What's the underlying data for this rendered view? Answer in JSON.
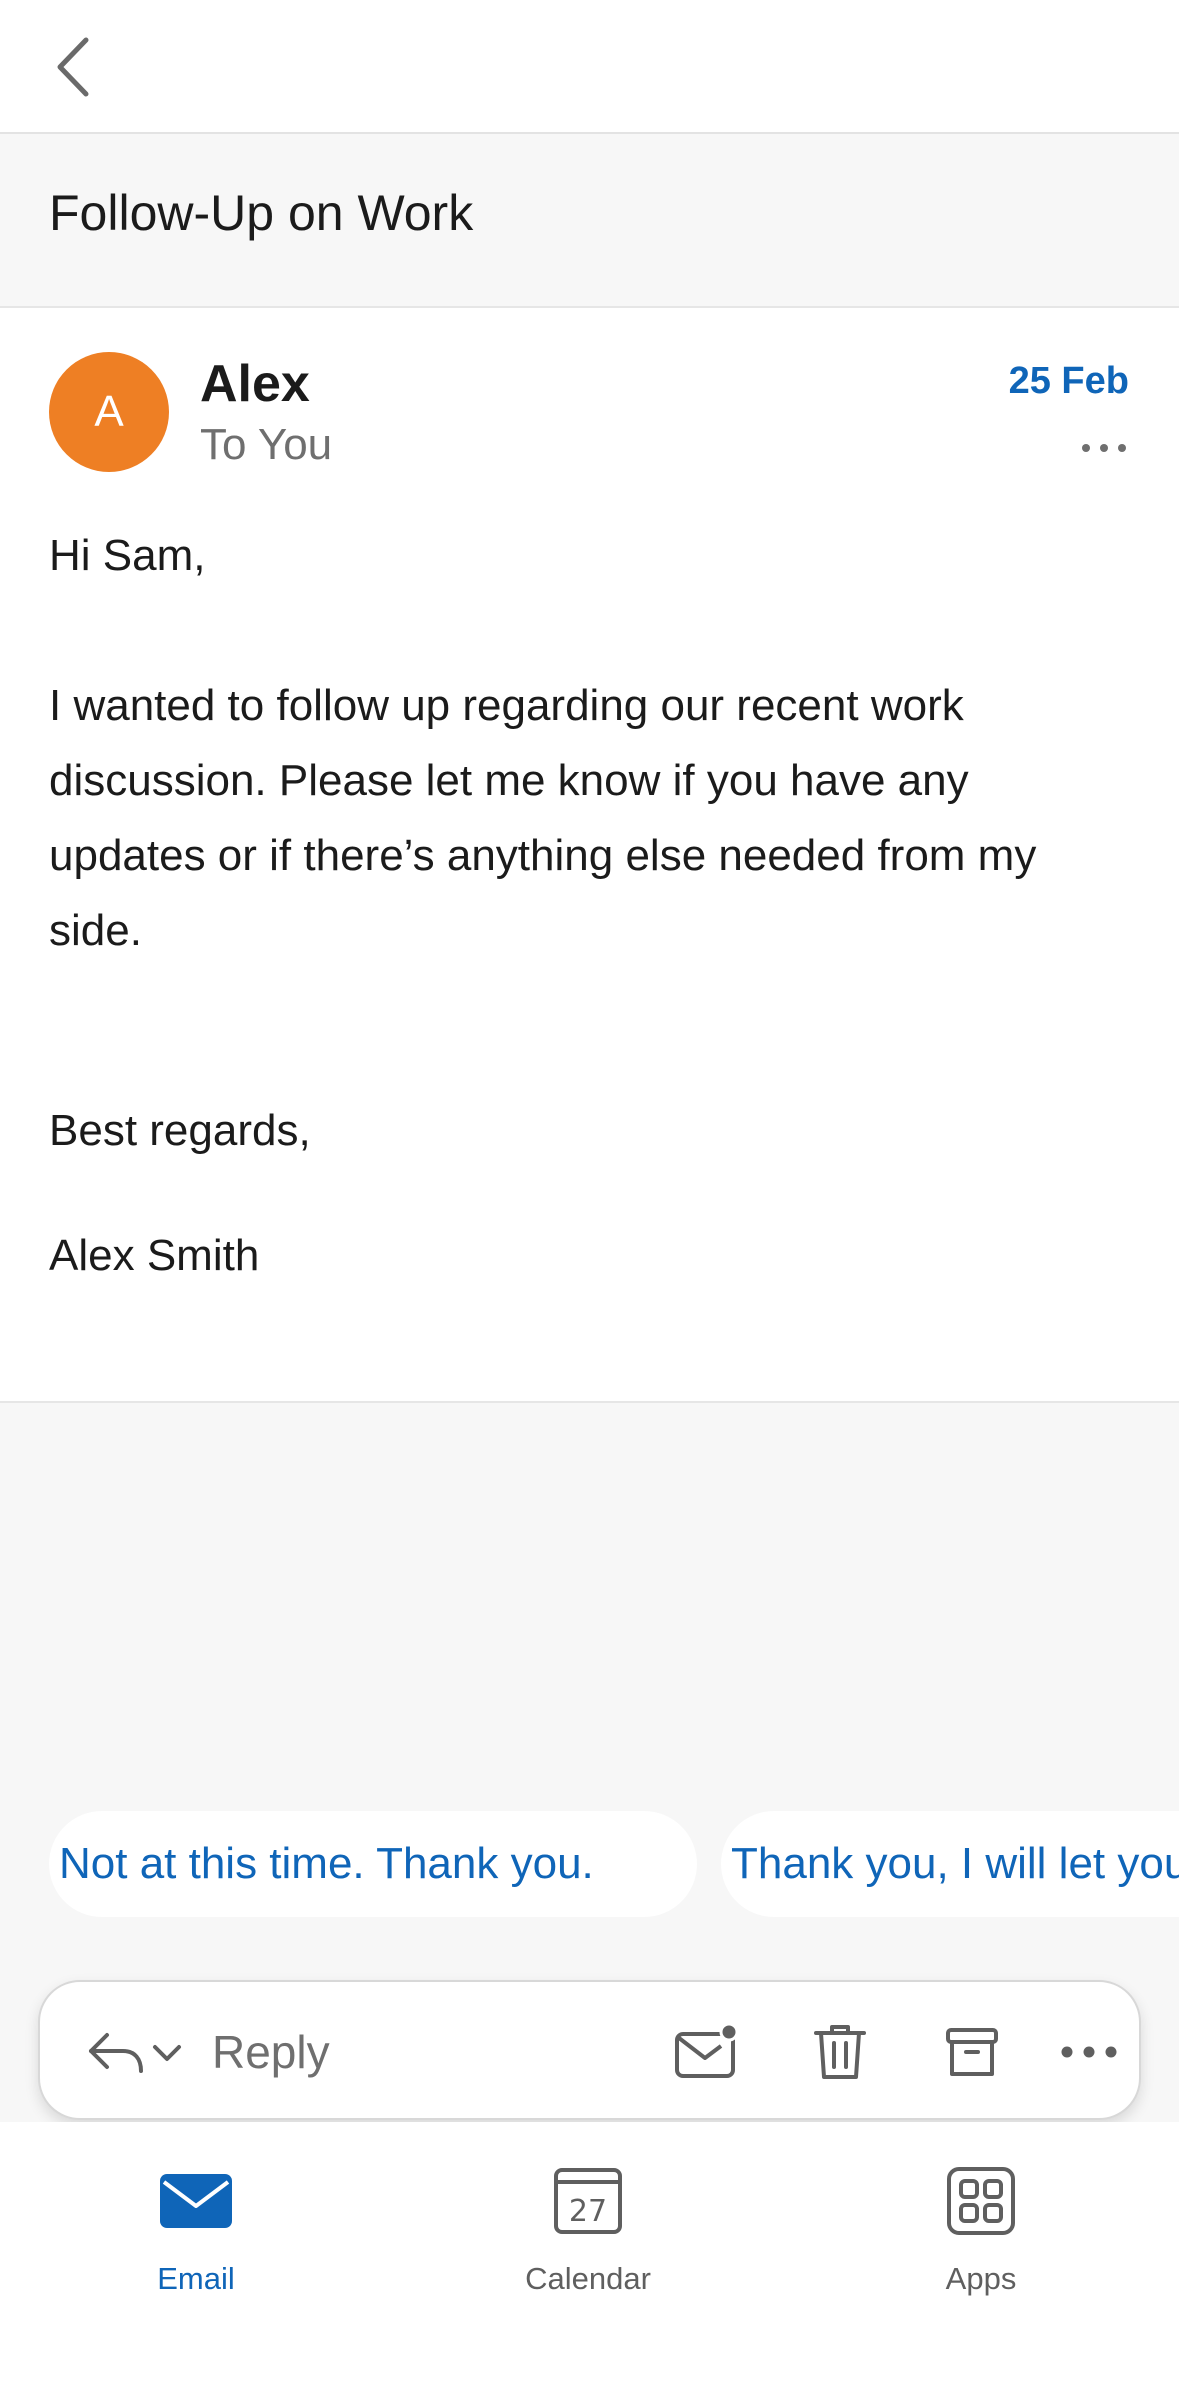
{
  "subject": "Follow-Up on Work",
  "message": {
    "avatar_initial": "A",
    "sender": "Alex",
    "recipient": "To You",
    "date": "25 Feb",
    "greeting": "Hi Sam,",
    "paragraph": "I wanted to follow up regarding our recent work discussion. Please let me know if you have any updates or if there’s anything else needed from my side.",
    "closing": "Best regards,",
    "signature": "Alex Smith"
  },
  "suggestions": [
    "Not at this time. Thank you.",
    "Thank you, I will let you know"
  ],
  "reply_bar": {
    "reply_label": "Reply"
  },
  "tabs": [
    {
      "label": "Email",
      "active": true
    },
    {
      "label": "Calendar",
      "calendar_day": "27"
    },
    {
      "label": "Apps"
    }
  ],
  "colors": {
    "accent": "#0f65b8",
    "avatar": "#ee7f24"
  },
  "icons": [
    "back-chevron-icon",
    "more-horizontal-icon",
    "reply-arrow-icon",
    "chevron-down-icon",
    "mark-unread-icon",
    "trash-icon",
    "archive-icon",
    "email-icon",
    "calendar-icon",
    "apps-icon"
  ]
}
